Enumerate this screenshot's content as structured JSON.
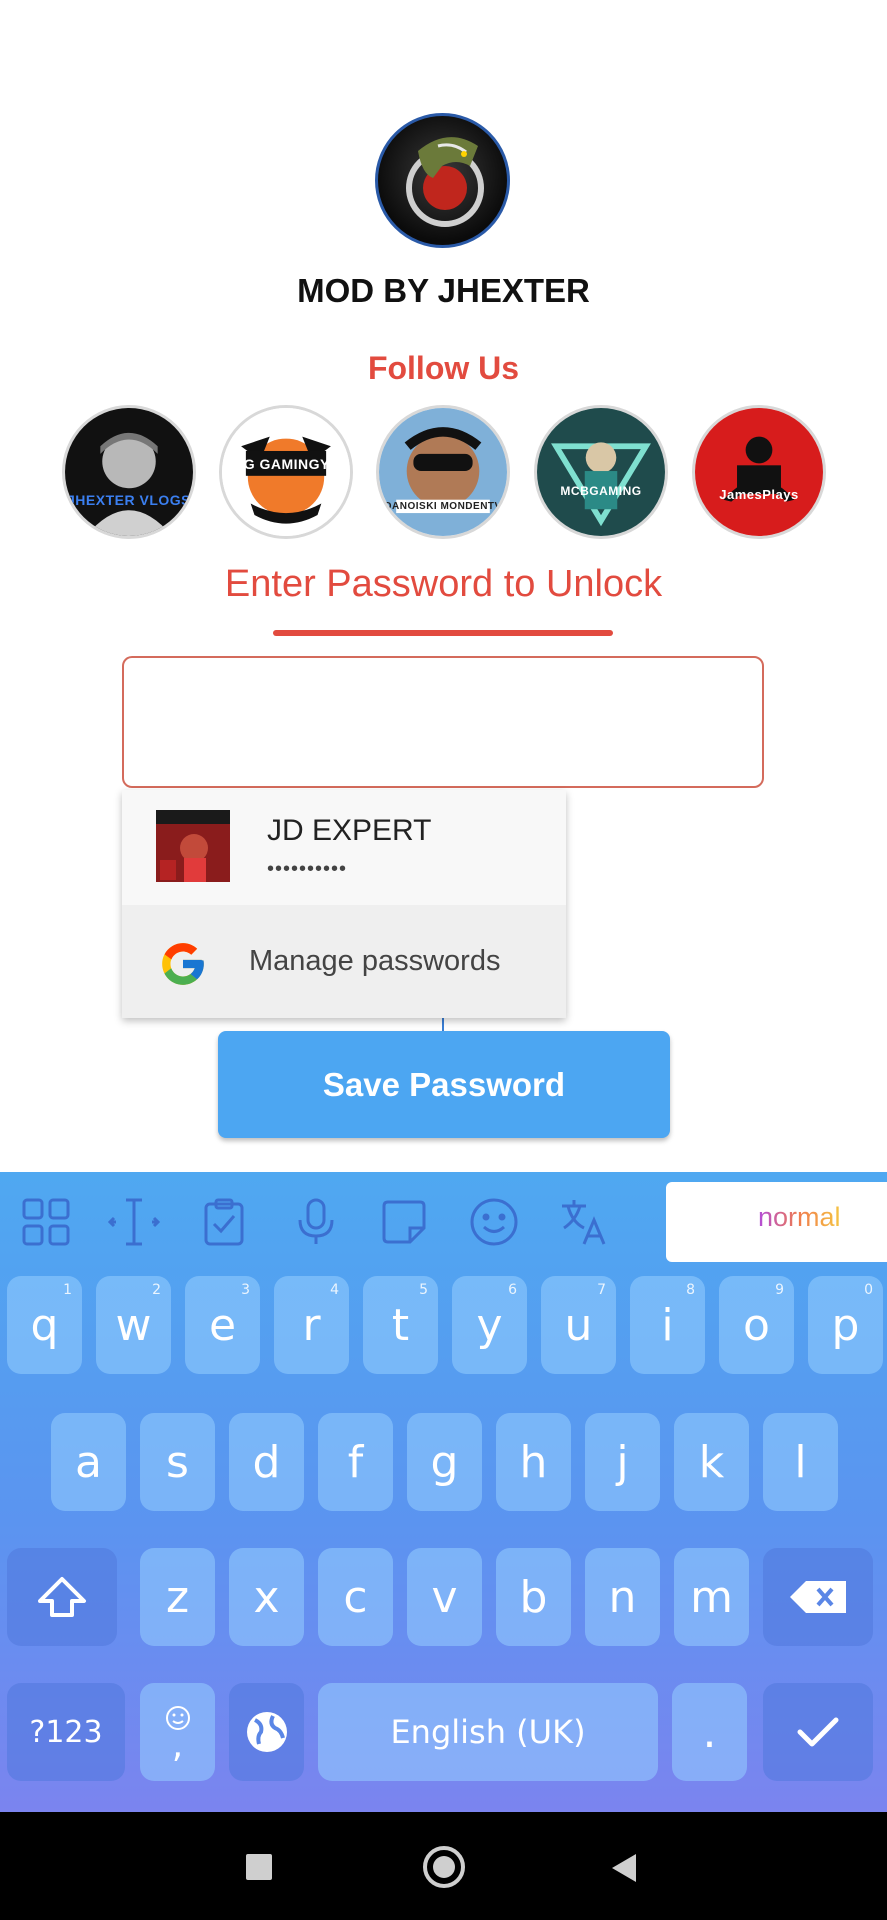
{
  "app": {
    "title": "MOD BY JHEXTER"
  },
  "follow": {
    "title": "Follow Us",
    "channels": [
      {
        "name": "JHEXTER VLOGS",
        "color": "#2b6de0",
        "bg": "#111111"
      },
      {
        "name": "AG GAMINGYT",
        "color": "#ffffff",
        "bg": "#ffffff"
      },
      {
        "name": "DANOISKI MONDENTV",
        "color": "#ffffff",
        "bg": "#7fb0d8"
      },
      {
        "name": "MCBGAMING",
        "color": "#ffffff",
        "bg": "#1f4b4c"
      },
      {
        "name": "JamesPlays",
        "color": "#ffffff",
        "bg": "#d71c1c"
      }
    ]
  },
  "unlock": {
    "title": "Enter Password to Unlock",
    "input_value": "",
    "accent_color": "#e24b3f"
  },
  "autofill": {
    "account_name": "JD EXPERT",
    "masked_password": "••••••••••",
    "manage_label": "Manage passwords"
  },
  "save_button": {
    "label": "Save Password"
  },
  "keyboard": {
    "theme_label": "normal",
    "row1": [
      {
        "k": "q",
        "h": "1"
      },
      {
        "k": "w",
        "h": "2"
      },
      {
        "k": "e",
        "h": "3"
      },
      {
        "k": "r",
        "h": "4"
      },
      {
        "k": "t",
        "h": "5"
      },
      {
        "k": "y",
        "h": "6"
      },
      {
        "k": "u",
        "h": "7"
      },
      {
        "k": "i",
        "h": "8"
      },
      {
        "k": "o",
        "h": "9"
      },
      {
        "k": "p",
        "h": "0"
      }
    ],
    "row2": [
      "a",
      "s",
      "d",
      "f",
      "g",
      "h",
      "j",
      "k",
      "l"
    ],
    "row3": [
      "z",
      "x",
      "c",
      "v",
      "b",
      "n",
      "m"
    ],
    "symbols_label": "?123",
    "comma_label": ",",
    "space_label": "English (UK)",
    "period_label": "."
  }
}
